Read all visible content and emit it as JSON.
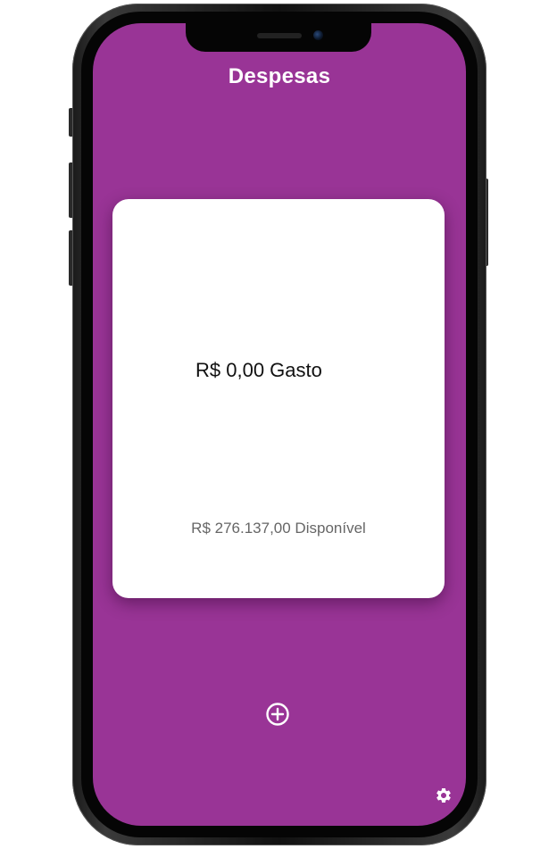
{
  "header": {
    "title": "Despesas"
  },
  "summary": {
    "spent": "R$ 0,00 Gasto",
    "available": "R$ 276.137,00 Disponível"
  },
  "actions": {
    "add_icon": "plus-circle-icon",
    "settings_icon": "gear-icon"
  },
  "colors": {
    "background": "#993496",
    "card": "#ffffff",
    "title_text": "#ffffff",
    "spent_text": "#111111",
    "available_text": "#666666"
  }
}
